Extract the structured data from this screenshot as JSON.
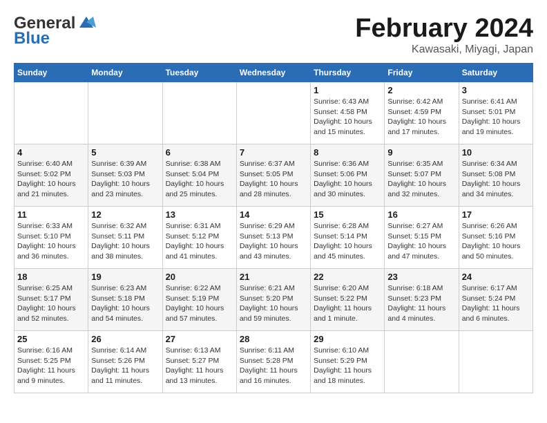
{
  "logo": {
    "general": "General",
    "blue": "Blue"
  },
  "title": "February 2024",
  "subtitle": "Kawasaki, Miyagi, Japan",
  "days_header": [
    "Sunday",
    "Monday",
    "Tuesday",
    "Wednesday",
    "Thursday",
    "Friday",
    "Saturday"
  ],
  "weeks": [
    [
      {
        "day": "",
        "info": ""
      },
      {
        "day": "",
        "info": ""
      },
      {
        "day": "",
        "info": ""
      },
      {
        "day": "",
        "info": ""
      },
      {
        "day": "1",
        "info": "Sunrise: 6:43 AM\nSunset: 4:58 PM\nDaylight: 10 hours\nand 15 minutes."
      },
      {
        "day": "2",
        "info": "Sunrise: 6:42 AM\nSunset: 4:59 PM\nDaylight: 10 hours\nand 17 minutes."
      },
      {
        "day": "3",
        "info": "Sunrise: 6:41 AM\nSunset: 5:01 PM\nDaylight: 10 hours\nand 19 minutes."
      }
    ],
    [
      {
        "day": "4",
        "info": "Sunrise: 6:40 AM\nSunset: 5:02 PM\nDaylight: 10 hours\nand 21 minutes."
      },
      {
        "day": "5",
        "info": "Sunrise: 6:39 AM\nSunset: 5:03 PM\nDaylight: 10 hours\nand 23 minutes."
      },
      {
        "day": "6",
        "info": "Sunrise: 6:38 AM\nSunset: 5:04 PM\nDaylight: 10 hours\nand 25 minutes."
      },
      {
        "day": "7",
        "info": "Sunrise: 6:37 AM\nSunset: 5:05 PM\nDaylight: 10 hours\nand 28 minutes."
      },
      {
        "day": "8",
        "info": "Sunrise: 6:36 AM\nSunset: 5:06 PM\nDaylight: 10 hours\nand 30 minutes."
      },
      {
        "day": "9",
        "info": "Sunrise: 6:35 AM\nSunset: 5:07 PM\nDaylight: 10 hours\nand 32 minutes."
      },
      {
        "day": "10",
        "info": "Sunrise: 6:34 AM\nSunset: 5:08 PM\nDaylight: 10 hours\nand 34 minutes."
      }
    ],
    [
      {
        "day": "11",
        "info": "Sunrise: 6:33 AM\nSunset: 5:10 PM\nDaylight: 10 hours\nand 36 minutes."
      },
      {
        "day": "12",
        "info": "Sunrise: 6:32 AM\nSunset: 5:11 PM\nDaylight: 10 hours\nand 38 minutes."
      },
      {
        "day": "13",
        "info": "Sunrise: 6:31 AM\nSunset: 5:12 PM\nDaylight: 10 hours\nand 41 minutes."
      },
      {
        "day": "14",
        "info": "Sunrise: 6:29 AM\nSunset: 5:13 PM\nDaylight: 10 hours\nand 43 minutes."
      },
      {
        "day": "15",
        "info": "Sunrise: 6:28 AM\nSunset: 5:14 PM\nDaylight: 10 hours\nand 45 minutes."
      },
      {
        "day": "16",
        "info": "Sunrise: 6:27 AM\nSunset: 5:15 PM\nDaylight: 10 hours\nand 47 minutes."
      },
      {
        "day": "17",
        "info": "Sunrise: 6:26 AM\nSunset: 5:16 PM\nDaylight: 10 hours\nand 50 minutes."
      }
    ],
    [
      {
        "day": "18",
        "info": "Sunrise: 6:25 AM\nSunset: 5:17 PM\nDaylight: 10 hours\nand 52 minutes."
      },
      {
        "day": "19",
        "info": "Sunrise: 6:23 AM\nSunset: 5:18 PM\nDaylight: 10 hours\nand 54 minutes."
      },
      {
        "day": "20",
        "info": "Sunrise: 6:22 AM\nSunset: 5:19 PM\nDaylight: 10 hours\nand 57 minutes."
      },
      {
        "day": "21",
        "info": "Sunrise: 6:21 AM\nSunset: 5:20 PM\nDaylight: 10 hours\nand 59 minutes."
      },
      {
        "day": "22",
        "info": "Sunrise: 6:20 AM\nSunset: 5:22 PM\nDaylight: 11 hours\nand 1 minute."
      },
      {
        "day": "23",
        "info": "Sunrise: 6:18 AM\nSunset: 5:23 PM\nDaylight: 11 hours\nand 4 minutes."
      },
      {
        "day": "24",
        "info": "Sunrise: 6:17 AM\nSunset: 5:24 PM\nDaylight: 11 hours\nand 6 minutes."
      }
    ],
    [
      {
        "day": "25",
        "info": "Sunrise: 6:16 AM\nSunset: 5:25 PM\nDaylight: 11 hours\nand 9 minutes."
      },
      {
        "day": "26",
        "info": "Sunrise: 6:14 AM\nSunset: 5:26 PM\nDaylight: 11 hours\nand 11 minutes."
      },
      {
        "day": "27",
        "info": "Sunrise: 6:13 AM\nSunset: 5:27 PM\nDaylight: 11 hours\nand 13 minutes."
      },
      {
        "day": "28",
        "info": "Sunrise: 6:11 AM\nSunset: 5:28 PM\nDaylight: 11 hours\nand 16 minutes."
      },
      {
        "day": "29",
        "info": "Sunrise: 6:10 AM\nSunset: 5:29 PM\nDaylight: 11 hours\nand 18 minutes."
      },
      {
        "day": "",
        "info": ""
      },
      {
        "day": "",
        "info": ""
      }
    ]
  ]
}
